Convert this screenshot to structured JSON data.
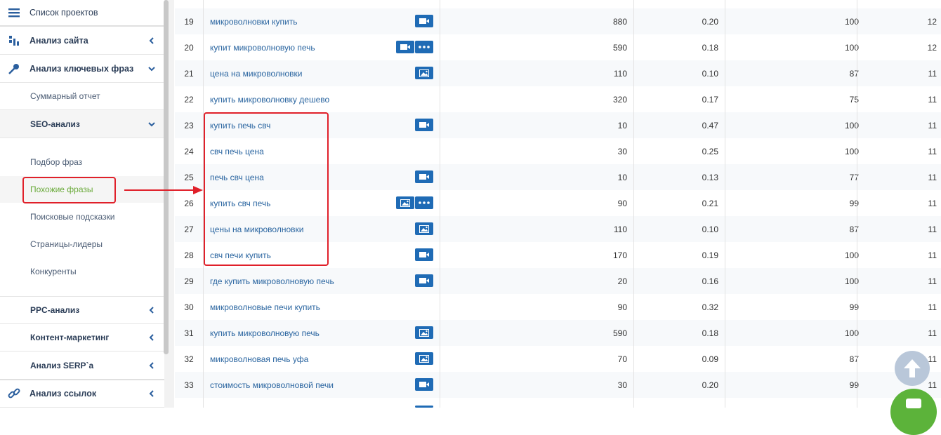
{
  "sidebar": {
    "project_list": "Список проектов",
    "site_analysis": "Анализ сайта",
    "keyword_analysis": "Анализ ключевых фраз",
    "summary_report": "Суммарный отчет",
    "seo_analysis": "SEO-анализ",
    "phrase_selection": "Подбор фраз",
    "similar_phrases": "Похожие фразы",
    "search_suggestions": "Поисковые подсказки",
    "leader_pages": "Страницы-лидеры",
    "competitors": "Конкуренты",
    "ppc_analysis": "PPC-анализ",
    "content_marketing": "Контент-маркетинг",
    "serp_analysis": "Анализ SERP`а",
    "link_analysis": "Анализ ссылок"
  },
  "table": {
    "rows": [
      {
        "num": "19",
        "phrase": "микроволновки купить",
        "badges": [
          "video"
        ],
        "v1": "880",
        "v2": "0.20",
        "v3": "100",
        "v4": "12"
      },
      {
        "num": "20",
        "phrase": "купит микроволновую печь",
        "badges": [
          "video",
          "more"
        ],
        "v1": "590",
        "v2": "0.18",
        "v3": "100",
        "v4": "12"
      },
      {
        "num": "21",
        "phrase": "цена на микроволновки",
        "badges": [
          "image"
        ],
        "v1": "110",
        "v2": "0.10",
        "v3": "87",
        "v4": "11"
      },
      {
        "num": "22",
        "phrase": "купить микроволновку дешево",
        "badges": [],
        "v1": "320",
        "v2": "0.17",
        "v3": "75",
        "v4": "11"
      },
      {
        "num": "23",
        "phrase": "купить печь свч",
        "badges": [
          "video"
        ],
        "v1": "10",
        "v2": "0.47",
        "v3": "100",
        "v4": "11"
      },
      {
        "num": "24",
        "phrase": "свч печь цена",
        "badges": [],
        "v1": "30",
        "v2": "0.25",
        "v3": "100",
        "v4": "11"
      },
      {
        "num": "25",
        "phrase": "печь свч цена",
        "badges": [
          "video"
        ],
        "v1": "10",
        "v2": "0.13",
        "v3": "77",
        "v4": "11"
      },
      {
        "num": "26",
        "phrase": "купить свч печь",
        "badges": [
          "image",
          "more"
        ],
        "v1": "90",
        "v2": "0.21",
        "v3": "99",
        "v4": "11"
      },
      {
        "num": "27",
        "phrase": "цены на микроволновки",
        "badges": [
          "image"
        ],
        "v1": "110",
        "v2": "0.10",
        "v3": "87",
        "v4": "11"
      },
      {
        "num": "28",
        "phrase": "свч печи купить",
        "badges": [
          "video"
        ],
        "v1": "170",
        "v2": "0.19",
        "v3": "100",
        "v4": "11"
      },
      {
        "num": "29",
        "phrase": "где купить микроволновую печь",
        "badges": [
          "video"
        ],
        "v1": "20",
        "v2": "0.16",
        "v3": "100",
        "v4": "11"
      },
      {
        "num": "30",
        "phrase": "микроволновые печи купить",
        "badges": [],
        "v1": "90",
        "v2": "0.32",
        "v3": "99",
        "v4": "11"
      },
      {
        "num": "31",
        "phrase": "купить микроволновую печь",
        "badges": [
          "image"
        ],
        "v1": "590",
        "v2": "0.18",
        "v3": "100",
        "v4": "11"
      },
      {
        "num": "32",
        "phrase": "микроволновая печь уфа",
        "badges": [
          "image"
        ],
        "v1": "70",
        "v2": "0.09",
        "v3": "87",
        "v4": "11"
      },
      {
        "num": "33",
        "phrase": "стоимость микроволновой печи",
        "badges": [
          "video"
        ],
        "v1": "30",
        "v2": "0.20",
        "v3": "99",
        "v4": "11"
      }
    ]
  },
  "colors": {
    "accent": "#1f6bb5",
    "link": "#2a65a0",
    "highlight": "#e0202a",
    "active_menu": "#6aaa3a",
    "chat_button": "#5cb33a"
  }
}
